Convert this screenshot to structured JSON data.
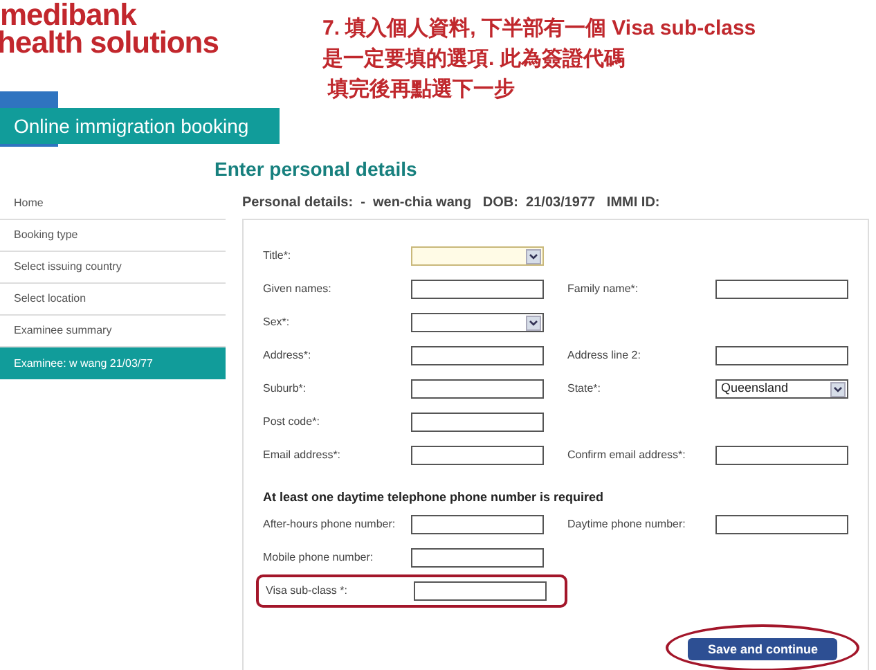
{
  "logo": {
    "brand": "medibank",
    "tagline": "health solutions"
  },
  "annotation": [
    "7. 填入個人資料, 下半部有一個 Visa sub-class",
    "是一定要填的選項. 此為簽證代碼",
    "填完後再點選下一步"
  ],
  "banner": {
    "title": "Online immigration booking"
  },
  "sidebar": {
    "items": [
      {
        "label": "Home",
        "selected": false
      },
      {
        "label": "Booking type",
        "selected": false
      },
      {
        "label": "Select issuing country",
        "selected": false
      },
      {
        "label": "Select location",
        "selected": false
      },
      {
        "label": "Examinee summary",
        "selected": false
      },
      {
        "label": "Examinee: w wang 21/03/77",
        "selected": true
      }
    ]
  },
  "page_title": "Enter personal details",
  "personal_details": "Personal details:  -  wen-chia wang   DOB:  21/03/1977   IMMI ID:",
  "form": {
    "rows": [
      {
        "fields": [
          {
            "label": "Title*:",
            "kind": "select",
            "focused": true,
            "circled": false
          }
        ]
      },
      {
        "fields": [
          {
            "label": "Given names:",
            "kind": "text",
            "focused": false,
            "circled": false
          },
          {
            "label": "Family name*:",
            "kind": "text",
            "focused": false,
            "circled": false
          }
        ]
      },
      {
        "fields": [
          {
            "label": "Sex*:",
            "kind": "select",
            "focused": false,
            "circled": false
          }
        ]
      },
      {
        "fields": [
          {
            "label": "Address*:",
            "kind": "text",
            "focused": false,
            "circled": false
          },
          {
            "label": "Address line 2:",
            "kind": "text",
            "focused": false,
            "circled": false
          }
        ]
      },
      {
        "fields": [
          {
            "label": "Suburb*:",
            "kind": "text",
            "focused": false,
            "circled": false
          },
          {
            "label": "State*:",
            "kind": "select",
            "value": "Queensland",
            "focused": false,
            "circled": false
          }
        ]
      },
      {
        "fields": [
          {
            "label": "Post code*:",
            "kind": "text",
            "focused": false,
            "circled": false
          }
        ]
      },
      {
        "fields": [
          {
            "label": "Email address*:",
            "kind": "text",
            "focused": false,
            "circled": false
          },
          {
            "label": "Confirm email address*:",
            "kind": "text",
            "focused": false,
            "circled": false
          }
        ]
      }
    ],
    "phone_heading": "At least one daytime telephone phone number is required",
    "phone_rows": [
      {
        "fields": [
          {
            "label": "After-hours phone number:",
            "kind": "text",
            "focused": false,
            "circled": false
          },
          {
            "label": "Daytime phone number:",
            "kind": "text",
            "focused": false,
            "circled": false
          }
        ]
      },
      {
        "fields": [
          {
            "label": "Mobile phone number:",
            "kind": "text",
            "focused": false,
            "circled": false
          }
        ]
      },
      {
        "fields": [
          {
            "label": "Visa sub-class *:",
            "kind": "text",
            "focused": false,
            "circled": true
          }
        ]
      }
    ],
    "submit": {
      "label": "Save and continue",
      "circled": true
    }
  }
}
